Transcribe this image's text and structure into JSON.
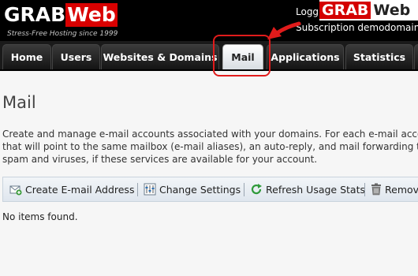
{
  "header": {
    "logo_part1": "GRAB",
    "logo_part2": "Web",
    "tagline": "Stress-Free Hosting since 1999",
    "logged_text": "Logg",
    "subscription_text": "Subscription  demodomain",
    "brand_overlay_part1": "GRAB",
    "brand_overlay_part2": "Web"
  },
  "nav": {
    "tabs": [
      {
        "label": "Home"
      },
      {
        "label": "Users"
      },
      {
        "label": "Websites & Domains"
      },
      {
        "label": "Mail"
      },
      {
        "label": "Applications"
      },
      {
        "label": "Statistics"
      }
    ],
    "active": "Mail"
  },
  "main": {
    "title": "Mail",
    "description_lines": [
      "Create and manage e-mail accounts associated with your domains. For each e-mail accou",
      "that will point to the same mailbox (e-mail aliases), an auto-reply, and mail forwarding to",
      "spam and viruses, if these services are available for your account."
    ],
    "toolbar": {
      "create": "Create E-mail Address",
      "settings": "Change Settings",
      "refresh": "Refresh Usage Stats",
      "remove": "Remove"
    },
    "empty_message": "No items found."
  },
  "colors": {
    "accent_red": "#d90000",
    "header_bg": "#000000",
    "highlight": "#e01b1b"
  }
}
